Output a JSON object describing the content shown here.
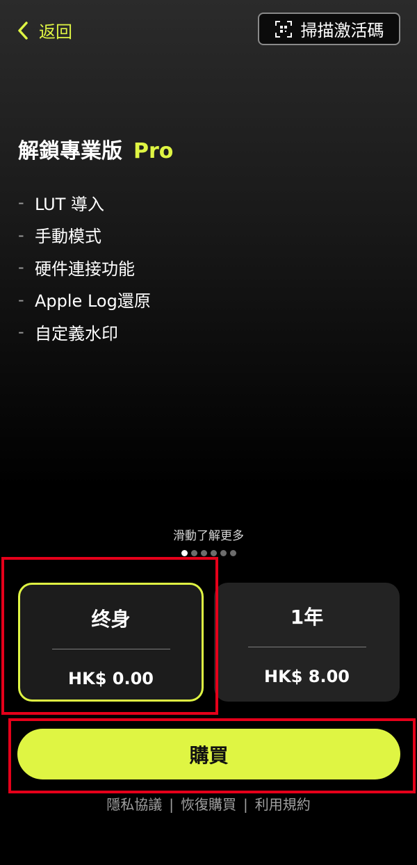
{
  "nav": {
    "back_label": "返回",
    "scan_label": "掃描激活碼"
  },
  "headline": {
    "title": "解鎖專業版",
    "badge": "Pro"
  },
  "features": [
    "LUT 導入",
    "手動模式",
    "硬件連接功能",
    "Apple Log還原",
    "自定義水印"
  ],
  "feature_dash": "-",
  "hint": "滑動了解更多",
  "pager": {
    "total": 6,
    "active": 0
  },
  "plans": [
    {
      "name": "终身",
      "price": "HK$ 0.00",
      "selected": true
    },
    {
      "name": "1年",
      "price": "HK$ 8.00",
      "selected": false
    }
  ],
  "buy_label": "購買",
  "footer": {
    "privacy": "隱私協議",
    "separator": "|",
    "restore": "恢復購買",
    "terms": "利用規約"
  },
  "colors": {
    "accent": "#dff543",
    "highlight_outline": "#e5001a",
    "background": "#000000"
  }
}
